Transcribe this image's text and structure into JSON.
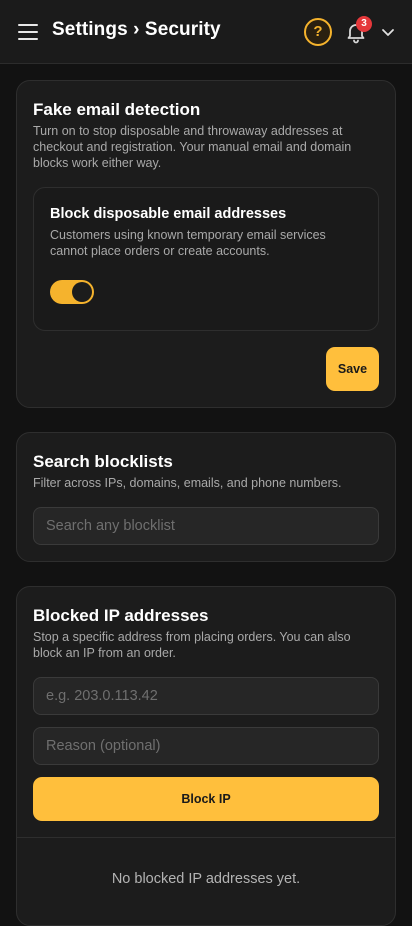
{
  "header": {
    "title": "Settings › Security",
    "help_icon": "?",
    "notification_count": "3",
    "accent_color": "#f5b32d",
    "badge_color": "#e5383b"
  },
  "fake_email": {
    "title": "Fake email detection",
    "description": "Turn on to stop disposable and throwaway addresses at checkout and registration. Your manual email and domain blocks work either way.",
    "setting": {
      "title": "Block disposable email addresses",
      "description": "Customers using known temporary email services cannot place orders or create accounts.",
      "toggle_on": true
    },
    "save_label": "Save"
  },
  "search": {
    "title": "Search blocklists",
    "description": "Filter across IPs, domains, emails, and phone numbers.",
    "placeholder": "Search any blocklist"
  },
  "blocked_ip": {
    "title": "Blocked IP addresses",
    "description": "Stop a specific address from placing orders. You can also block an IP from an order.",
    "ip_placeholder": "e.g. 203.0.113.42",
    "reason_placeholder": "Reason (optional)",
    "button_label": "Block IP",
    "empty_text": "No blocked IP addresses yet."
  }
}
